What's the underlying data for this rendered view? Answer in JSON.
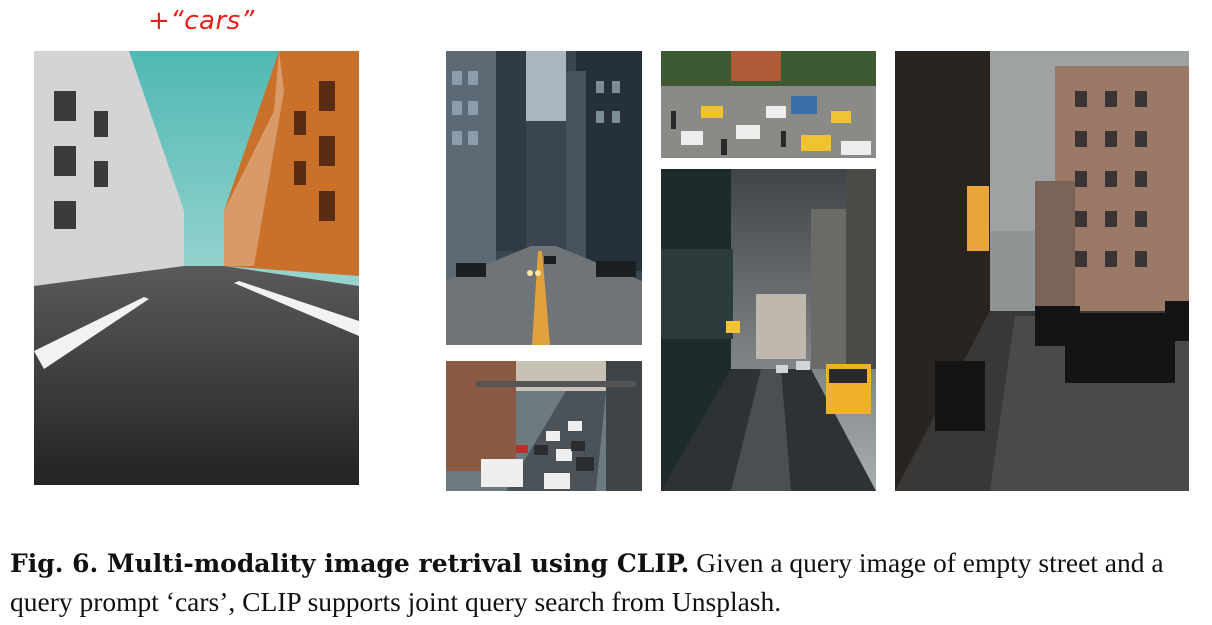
{
  "query_prompt_label": "+“cars”",
  "images": {
    "query": "empty-street-photo",
    "results": [
      "city-avenue-cars-photo",
      "busy-street-traffic-photo",
      "taxi-intersection-photo",
      "rainy-street-taxi-photo",
      "parked-cars-street-photo"
    ]
  },
  "caption": {
    "label": "Fig. 6. Multi-modality image retrival using CLIP.",
    "text": " Given a query image of empty street and a query prompt ‘cars’, CLIP supports joint query search from Unsplash."
  },
  "colors": {
    "prompt": "#e8221b"
  }
}
